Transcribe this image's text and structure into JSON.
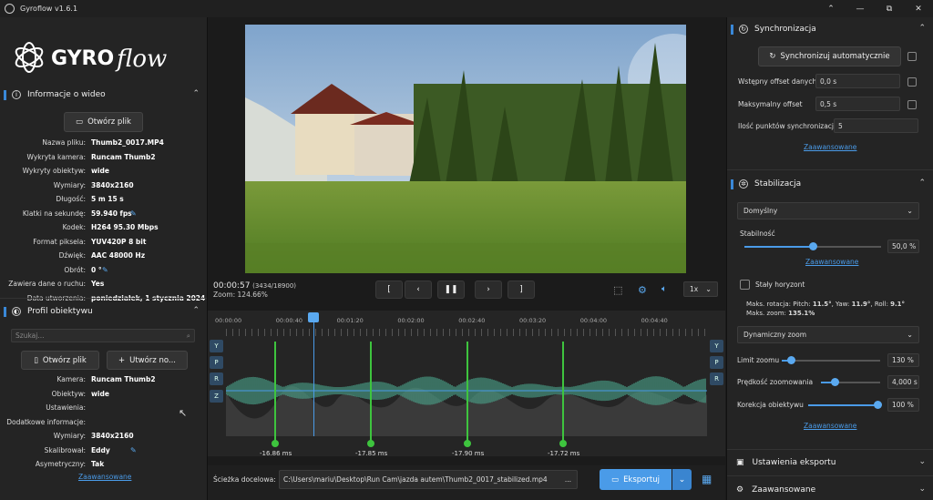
{
  "window": {
    "title": "Gyroflow v1.6.1"
  },
  "left": {
    "logo_text": "GYROflow",
    "video_info": {
      "header": "Informacje o wideo",
      "open_file": "Otwórz plik",
      "rows": [
        {
          "k": "Nazwa pliku:",
          "v": "Thumb2_0017.MP4"
        },
        {
          "k": "Wykryta kamera:",
          "v": "Runcam Thumb2"
        },
        {
          "k": "Wykryty obiektyw:",
          "v": "wide"
        },
        {
          "k": "Wymiary:",
          "v": "3840x2160"
        },
        {
          "k": "Długość:",
          "v": "5 m 15 s"
        },
        {
          "k": "Klatki na sekundę:",
          "v": "59.940 fps"
        },
        {
          "k": "Kodek:",
          "v": "H264 95.30 Mbps"
        },
        {
          "k": "Format piksela:",
          "v": "YUV420P 8 bit"
        },
        {
          "k": "Dźwięk:",
          "v": "AAC 48000 Hz"
        },
        {
          "k": "Obrót:",
          "v": "0 °"
        },
        {
          "k": "Zawiera dane o ruchu:",
          "v": "Yes"
        },
        {
          "k": "Data utworzenia:",
          "v": "poniedziałek, 1 stycznia 2024 00:"
        }
      ]
    },
    "lens": {
      "header": "Profil obiektywu",
      "search_placeholder": "Szukaj...",
      "open_file": "Otwórz plik",
      "create_new": "Utwórz no...",
      "rows": [
        {
          "k": "Kamera:",
          "v": "Runcam Thumb2"
        },
        {
          "k": "Obiektyw:",
          "v": "wide"
        },
        {
          "k": "Ustawienia:",
          "v": ""
        },
        {
          "k": "Dodatkowe informacje:",
          "v": ""
        },
        {
          "k": "Wymiary:",
          "v": "3840x2160"
        },
        {
          "k": "Skalibrował:",
          "v": "Eddy"
        },
        {
          "k": "Asymetryczny:",
          "v": "Tak"
        }
      ],
      "advanced": "Zaawansowane"
    }
  },
  "center": {
    "timecode": "00:00:57",
    "frames": "(3434/18900)",
    "zoom": "Zoom: 124.66%",
    "speed": "1x",
    "controls": [
      "[",
      "‹",
      "❚❚",
      "›",
      "]"
    ],
    "time_ticks": [
      "00:00:00",
      "00:00:40",
      "00:01:20",
      "00:02:00",
      "00:02:40",
      "00:03:20",
      "00:04:00",
      "00:04:40"
    ],
    "side_buttons": [
      "Y",
      "P",
      "R",
      "Z"
    ],
    "offsets": [
      "-16.86 ms",
      "-17.85 ms",
      "-17.90 ms",
      "-17.72 ms"
    ],
    "output_label": "Ścieżka docelowa:",
    "output_path": "C:\\Users\\mariu\\Desktop\\Run Cam\\jazda autem\\Thumb2_0017_stabilized.mp4",
    "export": "Eksportuj",
    "browse": "..."
  },
  "right": {
    "sync": {
      "header": "Synchronizacja",
      "auto_sync": "Synchronizuj automatycznie",
      "initial_offset_label": "Wstępny offset danych",
      "initial_offset": "0,0 s",
      "max_offset_label": "Maksymalny offset",
      "max_offset": "0,5 s",
      "points_label": "Ilość punktów synchronizacji",
      "points": "5",
      "advanced": "Zaawansowane"
    },
    "stab": {
      "header": "Stabilizacja",
      "method": "Domyślny",
      "smoothness_label": "Stabilność",
      "smoothness": "50,0 %",
      "smoothness_frac": 0.5,
      "advanced": "Zaawansowane",
      "horizon_label": "Stały horyzont",
      "max_rot": "Maks. rotacja: Pitch:",
      "pitch": "11.5°",
      "yaw_l": ", Yaw:",
      "yaw": "11.9°",
      "roll_l": ", Roll:",
      "roll": "9.1°",
      "max_zoom_l": "Maks. zoom:",
      "max_zoom": "135.1%",
      "zoom_mode": "Dynamiczny zoom",
      "zoom_limit_label": "Limit zoomu",
      "zoom_limit": "130 %",
      "zoom_speed_label": "Prędkość zoomowania",
      "zoom_speed": "4,000 s",
      "lens_corr_label": "Korekcja obiektywu",
      "lens_corr": "100 %",
      "advanced2": "Zaawansowane"
    },
    "export_settings": "Ustawienia eksportu",
    "advanced_section": "Zaawansowane"
  }
}
